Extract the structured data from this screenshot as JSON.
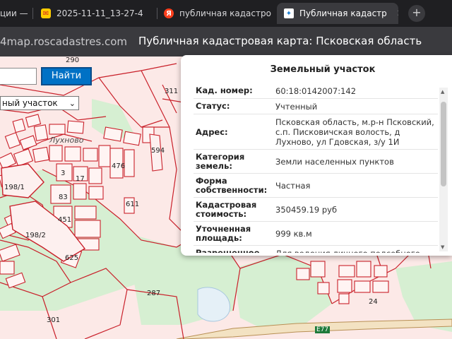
{
  "browser": {
    "tabs": [
      {
        "label": "ции —",
        "icon": "generic-page-icon"
      },
      {
        "label": "2025-11-11_13-27-4",
        "icon": "mail-icon"
      },
      {
        "label": "публичная кадастро",
        "icon": "yandex-icon"
      },
      {
        "label": "Публичная кадастр",
        "icon": "rosreestr-icon",
        "active": true
      }
    ],
    "close_glyph": "✕",
    "new_tab_glyph": "+",
    "url": "4map.roscadastres.com",
    "page_title": "Публичная кадастровая карта: Псковская область"
  },
  "search": {
    "button_label": "Найти",
    "input_value": "",
    "type_select_value": "ный участок"
  },
  "map": {
    "labels": [
      "290",
      "311",
      "Лухново",
      "198/1",
      "83",
      "451",
      "198/2",
      "625",
      "287",
      "301",
      "24",
      "594",
      "476",
      "3",
      "17",
      "611",
      "E77"
    ]
  },
  "popup": {
    "title": "Земельный участок",
    "rows": [
      {
        "key": "Кад. номер:",
        "value": "60:18:0142007:142"
      },
      {
        "key": "Статус:",
        "value": "Учтенный"
      },
      {
        "key": "Адрес:",
        "value": "Псковская область, м.р-н Псковский, с.п. Писковичская волость, д Лухново, ул Гдовская, з/у 1И"
      },
      {
        "key": "Категория земель:",
        "value": "Земли населенных пунктов"
      },
      {
        "key": "Форма собственности:",
        "value": "Частная"
      },
      {
        "key": "Кадастровая стоимость:",
        "value": "350459.19 руб"
      },
      {
        "key": "Уточненная площадь:",
        "value": "999 кв.м"
      },
      {
        "key": "Разрешенное",
        "value": "Для ведения личного подсобного"
      }
    ]
  },
  "colors": {
    "parcel_border": "#c9202a",
    "map_background": "#fce9e7",
    "green_area": "#d6efd2",
    "search_button": "#0071c5"
  }
}
